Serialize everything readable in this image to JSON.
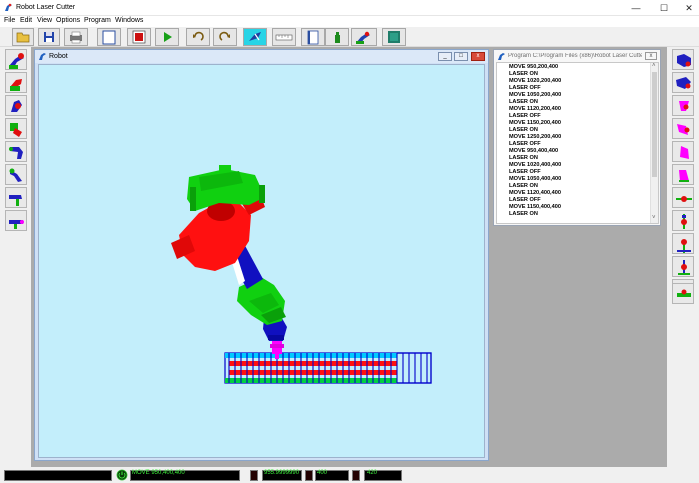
{
  "window": {
    "title": "Robot Laser Cutter",
    "min_glyph": "—",
    "max_glyph": "☐",
    "close_glyph": "✕"
  },
  "menu": [
    "File",
    "Edit",
    "View",
    "Options",
    "Program",
    "Windows"
  ],
  "toolbar": {
    "buttons": [
      "open-folder",
      "save",
      "print",
      "blank-page",
      "stop",
      "play",
      "undo",
      "redo",
      "laser-tool",
      "ruler",
      "page-view",
      "bottle-tool",
      "robot-arm-tool",
      "3d-box-tool"
    ]
  },
  "robot_window": {
    "title": "Robot",
    "min_glyph": "_",
    "max_glyph": "□",
    "close_glyph": "x"
  },
  "program_window": {
    "title": "Program C:\\Program Files (x86)\\Robot Laser Cutter...",
    "close_glyph": "x",
    "lines": [
      "MOVE 950,200,400",
      "LASER ON",
      "MOVE 1020,200,400",
      "LASER OFF",
      "MOVE 1050,200,400",
      "LASER ON",
      "MOVE 1120,200,400",
      "LASER OFF",
      "MOVE 1150,200,400",
      "LASER ON",
      "MOVE 1250,200,400",
      "LASER OFF",
      "MOVE 950,400,400",
      "LASER ON",
      "MOVE 1020,400,400",
      "LASER OFF",
      "MOVE 1050,400,400",
      "LASER ON",
      "MOVE 1120,400,400",
      "LASER OFF",
      "MOVE 1150,400,400",
      "LASER ON"
    ],
    "scroll_up": "˄",
    "scroll_down": "˅"
  },
  "status": {
    "command": "MOVE 950,400,400",
    "x": "955.9999990",
    "y": "400",
    "z": "420",
    "text_color": "#3cf03c"
  },
  "colors": {
    "viewport_bg": "#c3eefb",
    "robot_base": "#00e000",
    "robot_body": "#ff0000",
    "robot_arm": "#1010c0",
    "tool": "#ff00ff",
    "workpiece_frame": "#00c8ff"
  }
}
